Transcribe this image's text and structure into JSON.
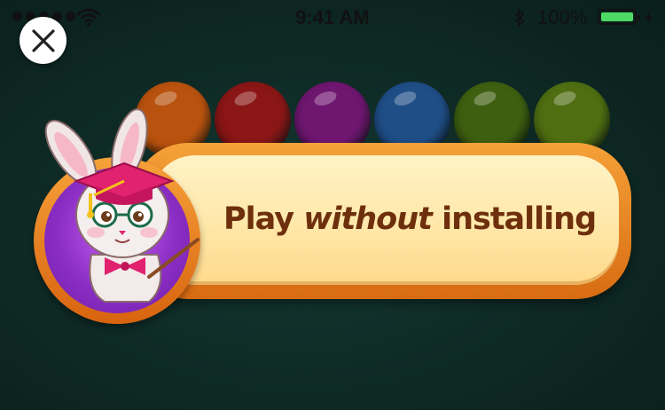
{
  "status_bar": {
    "time": "9:41 AM",
    "battery_percent": "100%",
    "battery_level": 1.0,
    "icons": [
      "signal-dots-icon",
      "wifi-icon",
      "bluetooth-icon",
      "battery-icon",
      "charging-bolt-icon"
    ]
  },
  "close_button": {
    "icon": "close-icon"
  },
  "banner": {
    "text_before": "Play ",
    "text_emphasis": "without",
    "text_after": " installing",
    "mascot": "bunny-teacher-mascot"
  },
  "colors": {
    "background": "#11302a",
    "banner_border": "#e8801f",
    "banner_fill": "#ffe9aa",
    "text": "#6d2f0c",
    "avatar_bg": "#8b2ec4",
    "battery_fill": "#4cd964"
  },
  "bubbles": [
    "#b8520e",
    "#8a1616",
    "#6e1670",
    "#1f4d86",
    "#3e5f10",
    "#4f6e12"
  ]
}
